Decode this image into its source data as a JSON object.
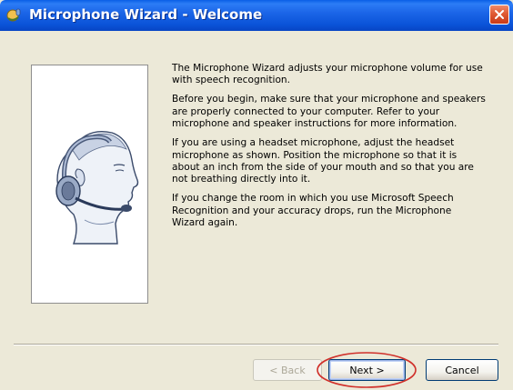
{
  "window": {
    "title": "Microphone Wizard - Welcome",
    "icon": "microphone-wizard-icon",
    "close_icon": "close-icon"
  },
  "illustration": {
    "icon": "headset-person-illustration"
  },
  "content": {
    "paragraphs": [
      "The Microphone Wizard adjusts your microphone volume for use with speech recognition.",
      "Before you begin, make sure that your microphone and speakers are properly connected to your computer. Refer to your microphone and speaker instructions for more information.",
      "If you are using a headset microphone, adjust the headset microphone as shown. Position the microphone so that it is about an inch from the side of your mouth and so that you are not breathing directly into it.",
      "If you change the room in which you use Microsoft Speech Recognition and your accuracy drops, run the Microphone Wizard again."
    ]
  },
  "buttons": {
    "back_label": "< Back",
    "next_label": "Next >",
    "cancel_label": "Cancel"
  },
  "colors": {
    "titlebar": "#0A53D8",
    "window_bg": "#ECE9D8",
    "annotation_ellipse": "#D0302A"
  }
}
